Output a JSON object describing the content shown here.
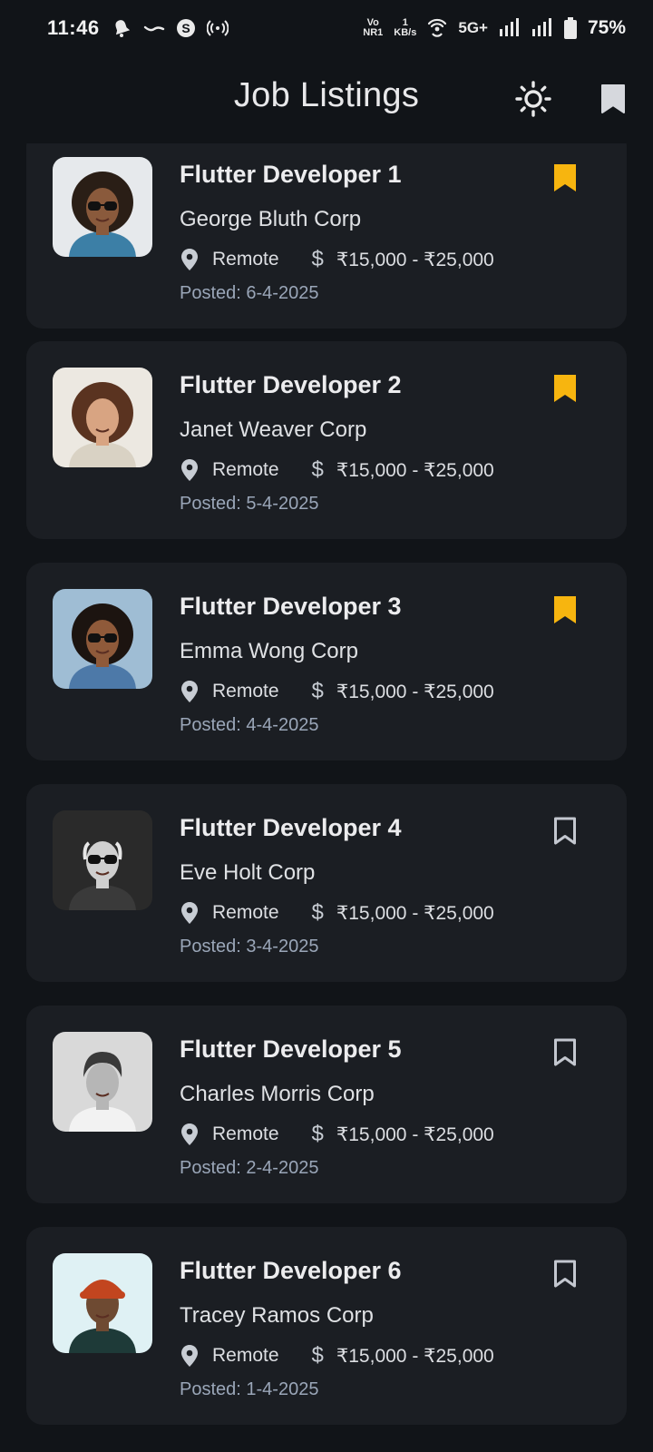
{
  "status_bar": {
    "time": "11:46",
    "net_top": "Vo",
    "net_bottom": "NR1",
    "speed_top": "1",
    "speed_bottom": "KB/s",
    "network": "5G+",
    "battery": "75%",
    "icons": [
      "bell-icon",
      "tilde-icon",
      "s-circle-icon",
      "hotspot-icon",
      "wifi-icon",
      "signal-icon",
      "signal-icon-2",
      "battery-icon"
    ]
  },
  "app_bar": {
    "title": "Job Listings",
    "theme_icon": "sun-icon",
    "saved_icon": "bookmark-icon"
  },
  "colors": {
    "background": "#111418",
    "card": "#1b1e23",
    "bookmark_active": "#f7b50f",
    "bookmark_inactive": "#c3c7cf",
    "posted_text": "#9aa6b8"
  },
  "jobs": [
    {
      "title": "Flutter Developer 1",
      "company": "George Bluth Corp",
      "location": "Remote",
      "salary": "₹15,000 - ₹25,000",
      "posted": "Posted: 6-4-2025",
      "bookmarked": true
    },
    {
      "title": "Flutter Developer 2",
      "company": "Janet Weaver Corp",
      "location": "Remote",
      "salary": "₹15,000 - ₹25,000",
      "posted": "Posted: 5-4-2025",
      "bookmarked": true
    },
    {
      "title": "Flutter Developer 3",
      "company": "Emma Wong Corp",
      "location": "Remote",
      "salary": "₹15,000 - ₹25,000",
      "posted": "Posted: 4-4-2025",
      "bookmarked": true
    },
    {
      "title": "Flutter Developer 4",
      "company": "Eve Holt Corp",
      "location": "Remote",
      "salary": "₹15,000 - ₹25,000",
      "posted": "Posted: 3-4-2025",
      "bookmarked": false
    },
    {
      "title": "Flutter Developer 5",
      "company": "Charles Morris Corp",
      "location": "Remote",
      "salary": "₹15,000 - ₹25,000",
      "posted": "Posted: 2-4-2025",
      "bookmarked": false
    },
    {
      "title": "Flutter Developer 6",
      "company": "Tracey Ramos Corp",
      "location": "Remote",
      "salary": "₹15,000 - ₹25,000",
      "posted": "Posted: 1-4-2025",
      "bookmarked": false
    }
  ]
}
